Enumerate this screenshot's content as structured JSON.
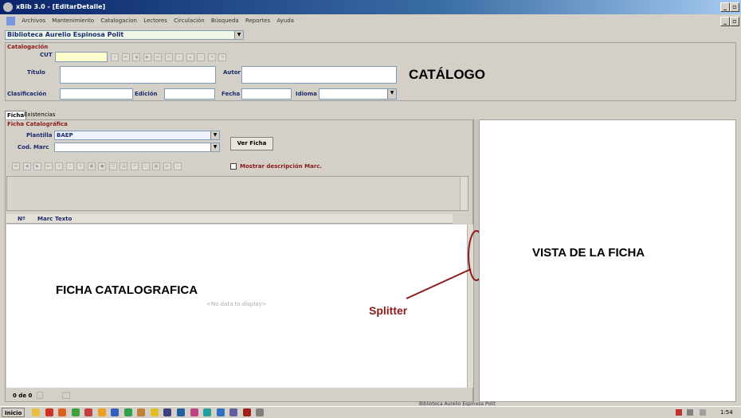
{
  "window": {
    "title": "xBib 3.0 - [EditarDetalle]"
  },
  "menu": {
    "items": [
      "Archivos",
      "Mantenimiento",
      "Catalogacion",
      "Lectores",
      "Circulación",
      "Búsqueda",
      "Reportes",
      "Ayuda"
    ]
  },
  "library": {
    "selected": "Biblioteca Aurelio Espinosa Polit"
  },
  "catalog": {
    "group_title": "Catalogación",
    "cut_label": "CUT",
    "titulo_label": "Título",
    "autor_label": "Autor",
    "clasificacion_label": "Clasificación",
    "edicion_label": "Edición",
    "fecha_label": "Fecha",
    "idioma_label": "Idioma",
    "annotation": "CATÁLOGO"
  },
  "tabs": {
    "ficha": "Ficha",
    "existencias": "Existencias"
  },
  "ficha": {
    "group_title": "Ficha Catalográfica",
    "plantilla_label": "Plantilla",
    "plantilla_value": "BAEP",
    "codmarc_label": "Cod. Marc",
    "ver_ficha_button": "Ver Ficha",
    "mostrar_label": "Mostrar descripción Marc.",
    "grid_headers": [
      "Nº",
      "Marc",
      "Texto"
    ],
    "no_data": "<No data to display>",
    "annotation": "FICHA CATALOGRAFICA",
    "record_counter": "0 de 0"
  },
  "splitter": {
    "annotation": "Splitter"
  },
  "vista": {
    "annotation": "VISTA DE LA FICHA"
  },
  "status": {
    "text": "Biblioteca Aurelio Espinosa Polit"
  },
  "taskbar": {
    "start_label": "Inicio",
    "clock": "1:54"
  },
  "colors": {
    "accent": "#8b1a1a",
    "title": "#0a246a",
    "label": "#1a2a6c"
  }
}
